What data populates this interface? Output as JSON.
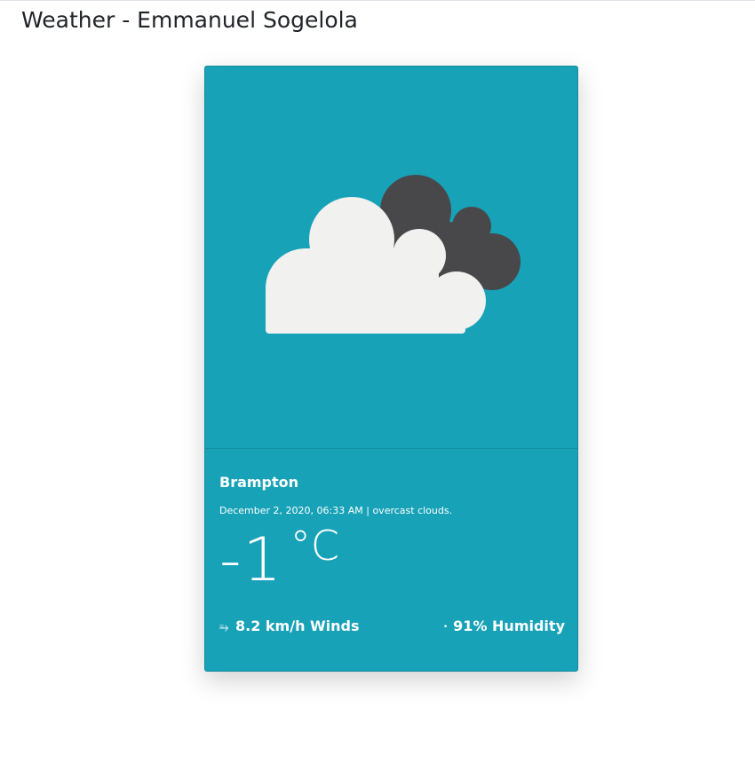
{
  "page": {
    "title": "Weather - Emmanuel Sogelola"
  },
  "weather": {
    "icon": "overcast-clouds-icon",
    "city": "Brampton",
    "date_time": "December 2, 2020, 06:33 AM",
    "separator": "|",
    "description": "overcast clouds.",
    "temperature": "-1",
    "unit": "°C",
    "wind_icon": "wind-icon",
    "wind_symbol": "⥱",
    "wind_text": "8.2 km/h Winds",
    "humidity_icon": "droplet-icon",
    "humidity_symbol": "•",
    "humidity_text": "91% Humidity"
  },
  "colors": {
    "card_background": "#17a2b8",
    "cloud_front": "#f1f1f0",
    "cloud_back": "#48484a",
    "text": "#ffffff"
  }
}
